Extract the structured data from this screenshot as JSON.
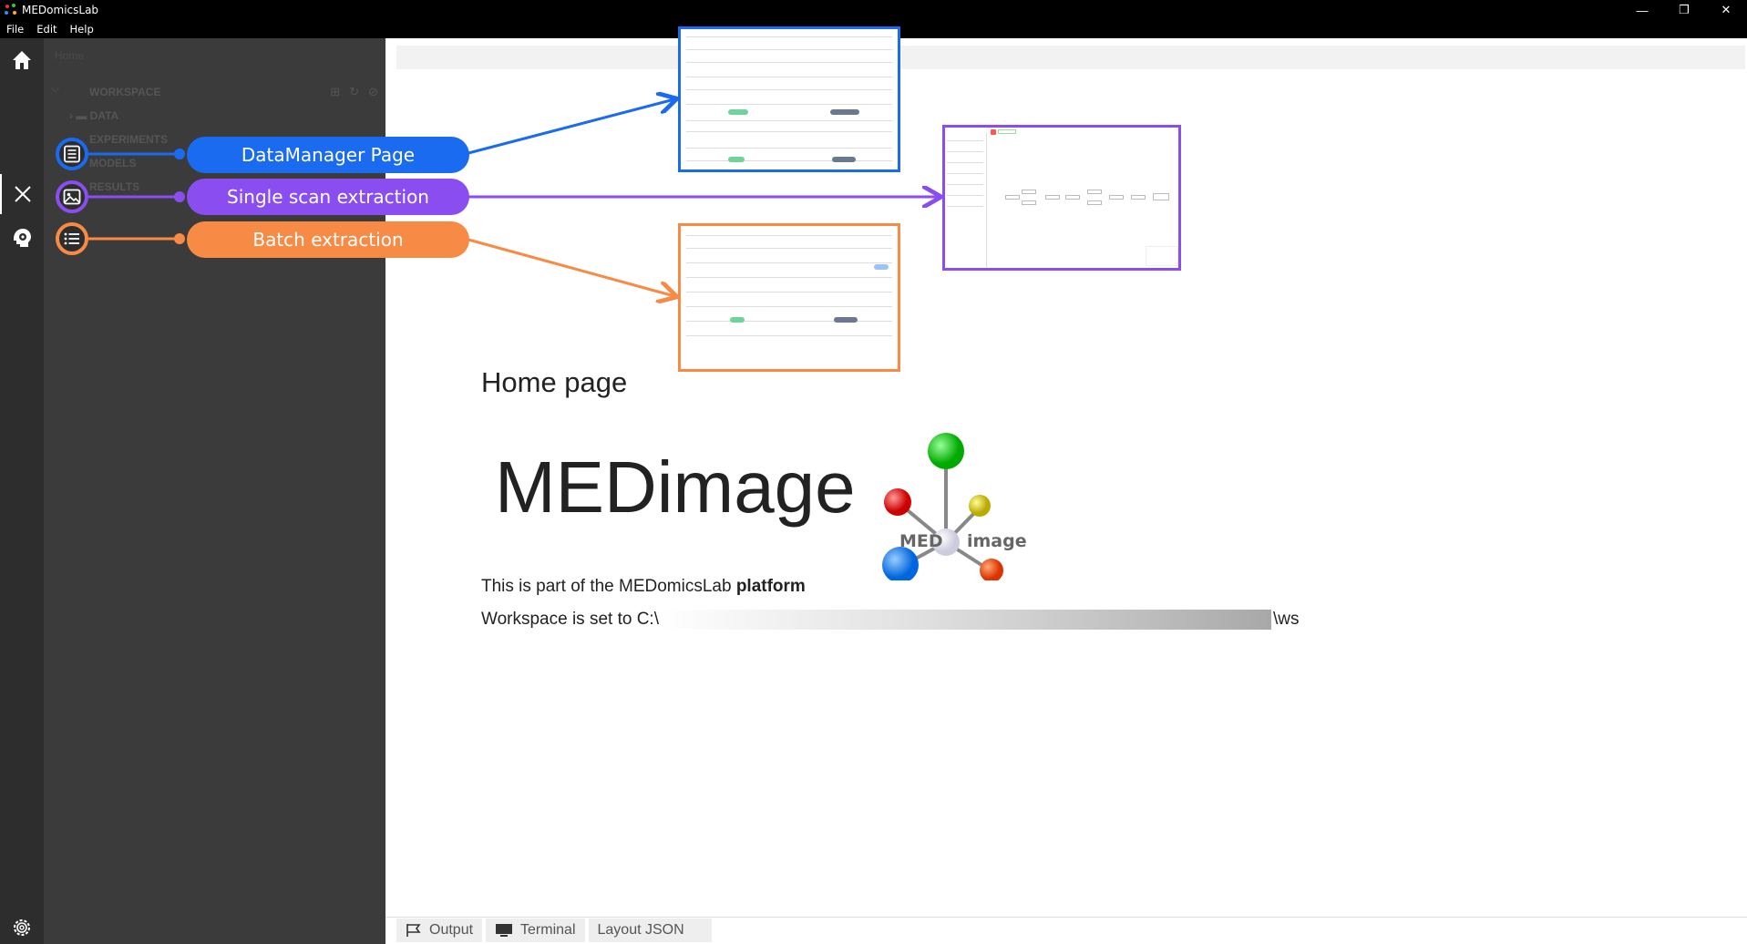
{
  "window": {
    "title": "MEDomicsLab",
    "buttons": [
      "—",
      "❐",
      "✕"
    ]
  },
  "menu": {
    "items": [
      "File",
      "Edit",
      "Help"
    ]
  },
  "sidebar": {
    "breadcrumb": "Home",
    "workspace_label": "WORKSPACE",
    "items": [
      "DATA",
      "EXPERIMENTS",
      "MODELS",
      "RESULTS"
    ]
  },
  "annotations": {
    "datamanager": {
      "label": "DataManager Page",
      "color": "#1a6bf0"
    },
    "single_scan": {
      "label": "Single scan extraction",
      "color": "#8a4ef0"
    },
    "batch": {
      "label": "Batch extraction",
      "color": "#f78a45"
    }
  },
  "main": {
    "page_title": "Home page",
    "logo_word": "MEDimage",
    "logo_med": "MED",
    "logo_image": "image",
    "platform_text": "This is part of the MEDomicsLab ",
    "platform_bold": "platform",
    "workspace_prefix": "Workspace is set to C:\\",
    "workspace_suffix": "\\ws"
  },
  "bottom_tabs": [
    "Output",
    "Terminal",
    "Layout JSON"
  ]
}
